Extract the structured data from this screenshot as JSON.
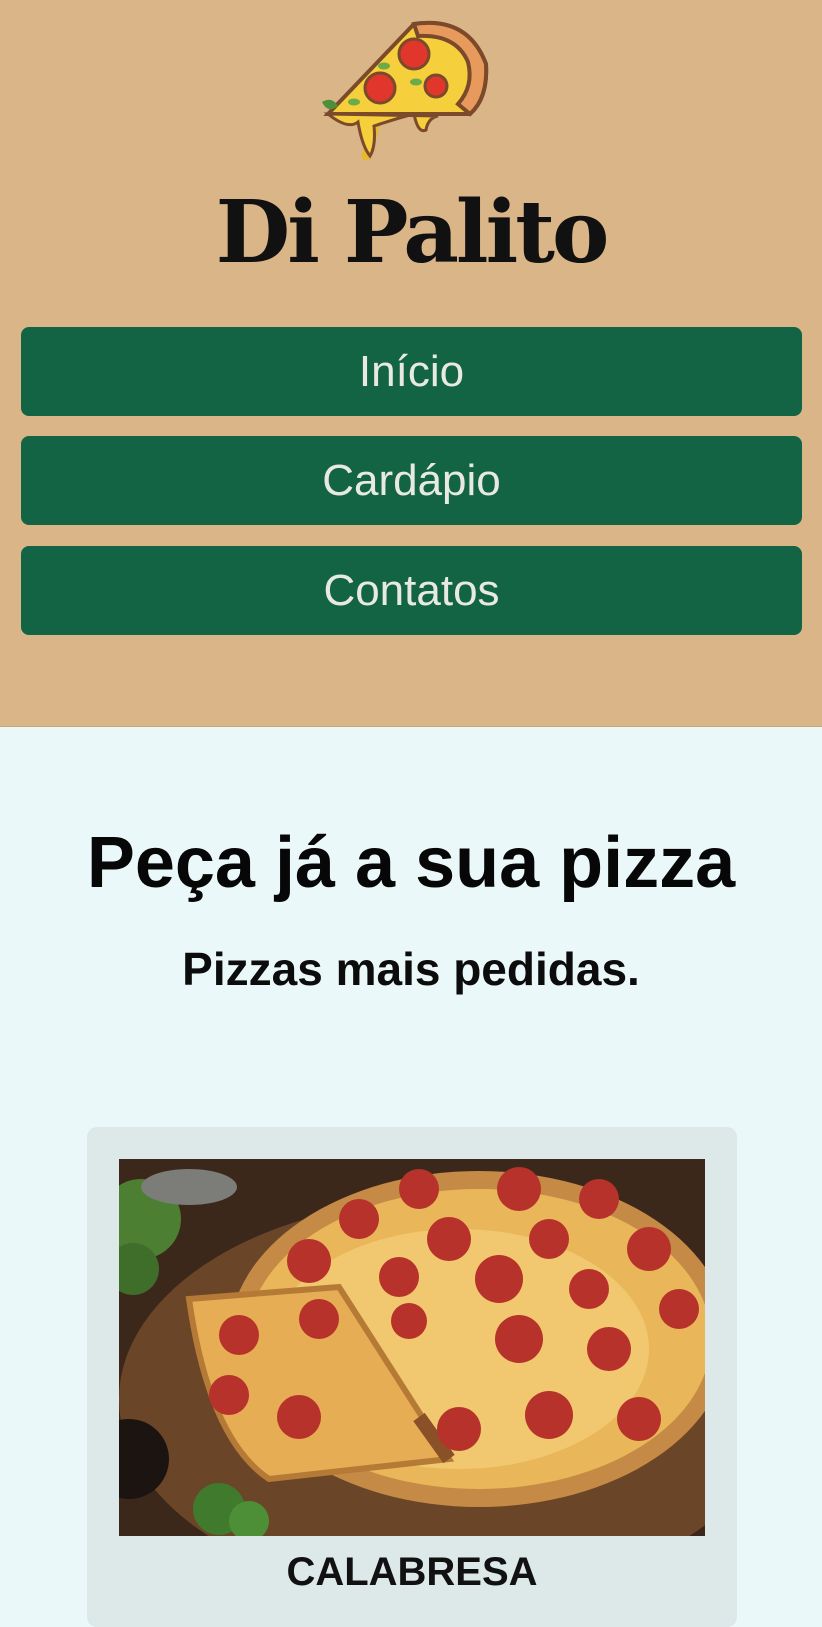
{
  "header": {
    "logo_icon": "pizza-slice-icon",
    "brand_name": "Di Palito",
    "background_color": "#dab588"
  },
  "nav": {
    "items": [
      {
        "label": "Início"
      },
      {
        "label": "Cardápio"
      },
      {
        "label": "Contatos"
      }
    ],
    "button_color": "#136444",
    "text_color": "#e9e9e3"
  },
  "main": {
    "headline": "Peça já a sua pizza",
    "subheadline": "Pizzas mais pedidas.",
    "background_color": "#ebf8f9"
  },
  "products": [
    {
      "name": "CALABRESA",
      "image": "pepperoni-pizza-photo"
    }
  ]
}
